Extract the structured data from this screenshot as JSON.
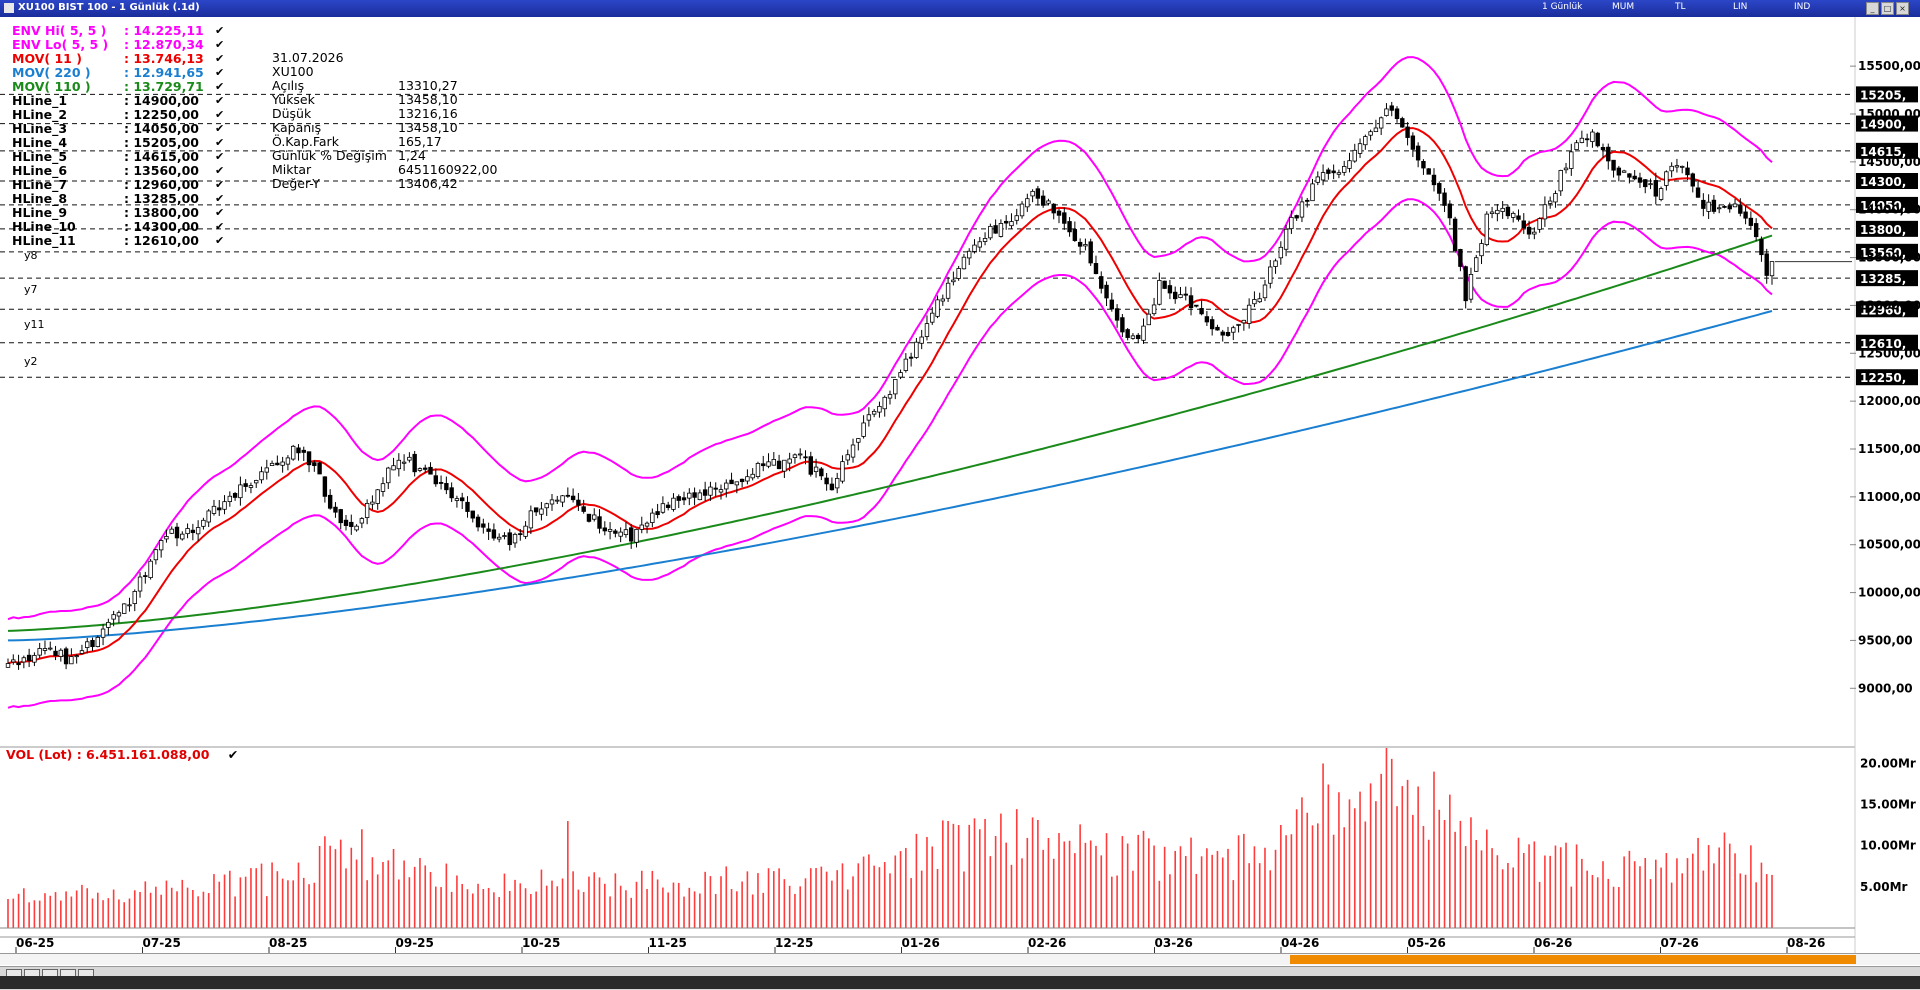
{
  "window": {
    "title": "XU100 BIST 100 - 1 Günlük (.1d)",
    "period_label": "1 Günlük",
    "toolbar_labels": [
      "MUM",
      "TL",
      "LIN",
      "IND"
    ]
  },
  "legend": [
    {
      "name": "ENV Hi( 5, 5 )",
      "value": ": 14.225,11",
      "color": "#ff00ff"
    },
    {
      "name": "ENV Lo( 5, 5 )",
      "value": ": 12.870,34",
      "color": "#ff00ff"
    },
    {
      "name": "MOV( 11 )",
      "value": ": 13.746,13",
      "color": "#ee0000"
    },
    {
      "name": "MOV( 220 )",
      "value": ": 12.941,65",
      "color": "#1a7fd0"
    },
    {
      "name": "MOV( 110 )",
      "value": ": 13.729,71",
      "color": "#1a8a1a"
    },
    {
      "name": "HLine_1",
      "value": ": 14900,00",
      "color": "#000000"
    },
    {
      "name": "HLine_2",
      "value": ": 12250,00",
      "color": "#000000"
    },
    {
      "name": "HLine_3",
      "value": ": 14050,00",
      "color": "#000000"
    },
    {
      "name": "HLine_4",
      "value": ": 15205,00",
      "color": "#000000"
    },
    {
      "name": "HLine_5",
      "value": ": 14615,00",
      "color": "#000000"
    },
    {
      "name": "HLine_6",
      "value": ": 13560,00",
      "color": "#000000"
    },
    {
      "name": "HLine_7",
      "value": ": 12960,00",
      "color": "#000000"
    },
    {
      "name": "HLine_8",
      "value": ": 13285,00",
      "color": "#000000"
    },
    {
      "name": "HLine_9",
      "value": ": 13800,00",
      "color": "#000000"
    },
    {
      "name": "HLine_10",
      "value": ": 14300,00",
      "color": "#000000"
    },
    {
      "name": "HLine_11",
      "value": ": 12610,00",
      "color": "#000000"
    }
  ],
  "ohlc": {
    "date": "31.07.2026",
    "symbol": "XU100",
    "rows": [
      {
        "label": "Açılış",
        "value": "13310,27"
      },
      {
        "label": "Yüksek",
        "value": "13458,10"
      },
      {
        "label": "Düşük",
        "value": "13216,16"
      },
      {
        "label": "Kapanış",
        "value": "13458,10"
      },
      {
        "label": "Ö.Kap.Fark",
        "value": "165,17"
      },
      {
        "label": "Günlük % Değişim",
        "value": "1,24"
      },
      {
        "label": "Miktar",
        "value": "6451160922,00"
      },
      {
        "label": "Değer-Y",
        "value": "13406,42"
      }
    ]
  },
  "hline_tags": [
    "y8",
    "y7",
    "y11",
    "y2"
  ],
  "volume_legend": "VOL (Lot) : 6.451.161.088,00",
  "chart_data": {
    "type": "candlestick",
    "x_ticks": [
      "06-25",
      "07-25",
      "08-25",
      "09-25",
      "10-25",
      "11-25",
      "12-25",
      "01-26",
      "02-26",
      "03-26",
      "04-26",
      "05-26",
      "06-26",
      "07-26",
      "08-26"
    ],
    "price_axis": {
      "ticks": [
        9000,
        9500,
        10000,
        10500,
        11000,
        11500,
        12000,
        12500,
        13000,
        13500,
        14000,
        14500,
        15000,
        15500
      ],
      "tick_labels": [
        "9000,00",
        "9500,00",
        "10000,00",
        "10500,00",
        "11000,00",
        "11500,00",
        "12000,00",
        "12500,00",
        "13000,00",
        "13500,00",
        "14000,00",
        "14500,00",
        "15000,00",
        "15500,00"
      ],
      "ylim": [
        8700,
        15700
      ]
    },
    "hlines": [
      {
        "name": "HLine_4",
        "value": 15205,
        "tag_label": "15205,"
      },
      {
        "name": "HLine_1",
        "value": 14900,
        "tag_label": "14900,"
      },
      {
        "name": "HLine_5",
        "value": 14615,
        "tag_label": "14615,"
      },
      {
        "name": "HLine_10",
        "value": 14300,
        "tag_label": "14300,"
      },
      {
        "name": "HLine_3",
        "value": 14050,
        "tag_label": "14050,"
      },
      {
        "name": "HLine_9",
        "value": 13800,
        "tag_label": "13800,"
      },
      {
        "name": "HLine_6",
        "value": 13560,
        "tag_label": "13560,"
      },
      {
        "name": "HLine_8",
        "value": 13285,
        "tag_label": "13285,"
      },
      {
        "name": "HLine_7",
        "value": 12960,
        "tag_label": "12960,"
      },
      {
        "name": "HLine_11",
        "value": 12610,
        "tag_label": "12610,"
      },
      {
        "name": "HLine_2",
        "value": 12250,
        "tag_label": "12250,"
      }
    ],
    "close_anchors": [
      [
        0,
        9200
      ],
      [
        6,
        9400
      ],
      [
        12,
        9300
      ],
      [
        18,
        9600
      ],
      [
        24,
        10000
      ],
      [
        30,
        10600
      ],
      [
        36,
        10700
      ],
      [
        42,
        11000
      ],
      [
        48,
        11200
      ],
      [
        54,
        11500
      ],
      [
        58,
        11300
      ],
      [
        62,
        10800
      ],
      [
        66,
        10650
      ],
      [
        70,
        11100
      ],
      [
        74,
        11400
      ],
      [
        78,
        11300
      ],
      [
        84,
        11000
      ],
      [
        90,
        10700
      ],
      [
        95,
        10500
      ],
      [
        100,
        10900
      ],
      [
        106,
        11000
      ],
      [
        112,
        10700
      ],
      [
        118,
        10600
      ],
      [
        124,
        10900
      ],
      [
        130,
        11000
      ],
      [
        136,
        11100
      ],
      [
        142,
        11300
      ],
      [
        150,
        11400
      ],
      [
        156,
        11100
      ],
      [
        160,
        11600
      ],
      [
        166,
        12000
      ],
      [
        172,
        12600
      ],
      [
        178,
        13200
      ],
      [
        184,
        13700
      ],
      [
        190,
        13900
      ],
      [
        194,
        14200
      ],
      [
        198,
        14000
      ],
      [
        204,
        13600
      ],
      [
        210,
        12800
      ],
      [
        214,
        12600
      ],
      [
        218,
        13200
      ],
      [
        222,
        13100
      ],
      [
        226,
        12900
      ],
      [
        230,
        12700
      ],
      [
        234,
        12900
      ],
      [
        238,
        13200
      ],
      [
        242,
        13800
      ],
      [
        248,
        14300
      ],
      [
        254,
        14500
      ],
      [
        258,
        14800
      ],
      [
        262,
        15100
      ],
      [
        266,
        14600
      ],
      [
        270,
        14300
      ],
      [
        273,
        13900
      ],
      [
        276,
        13100
      ],
      [
        280,
        13900
      ],
      [
        284,
        14000
      ],
      [
        288,
        13700
      ],
      [
        292,
        14100
      ],
      [
        296,
        14600
      ],
      [
        300,
        14800
      ],
      [
        304,
        14400
      ],
      [
        308,
        14300
      ],
      [
        312,
        14200
      ],
      [
        316,
        14500
      ],
      [
        320,
        14100
      ],
      [
        324,
        14000
      ],
      [
        328,
        14000
      ],
      [
        331,
        13700
      ],
      [
        333,
        13300
      ],
      [
        334,
        13458
      ]
    ],
    "ma11_final": 13746,
    "ma110_final": 13730,
    "ma220_final": 12942,
    "env_hi_final": 14225,
    "env_lo_final": 12870,
    "volume_axis": {
      "ticks": [
        5,
        10,
        15,
        20
      ],
      "tick_labels": [
        "5.00Mr",
        "10.00Mr",
        "15.00Mr",
        "20.00Mr"
      ],
      "unit": "Mr",
      "ylim": [
        0,
        22
      ]
    },
    "volume_anchors": [
      [
        0,
        3.5
      ],
      [
        30,
        4.5
      ],
      [
        50,
        6
      ],
      [
        62,
        9
      ],
      [
        75,
        7
      ],
      [
        90,
        5
      ],
      [
        100,
        6
      ],
      [
        115,
        5
      ],
      [
        130,
        6
      ],
      [
        150,
        5.5
      ],
      [
        165,
        8
      ],
      [
        175,
        10
      ],
      [
        190,
        11
      ],
      [
        210,
        9
      ],
      [
        230,
        8
      ],
      [
        245,
        12
      ],
      [
        255,
        14
      ],
      [
        262,
        17
      ],
      [
        268,
        15
      ],
      [
        278,
        10
      ],
      [
        290,
        8
      ],
      [
        310,
        7
      ],
      [
        325,
        9
      ],
      [
        334,
        6.5
      ]
    ],
    "volume_spikes": [
      [
        67,
        12
      ],
      [
        106,
        13
      ],
      [
        184,
        12
      ],
      [
        249,
        20
      ],
      [
        252,
        16.5
      ],
      [
        265,
        18
      ],
      [
        270,
        19
      ]
    ],
    "last_volume": 6.45
  }
}
